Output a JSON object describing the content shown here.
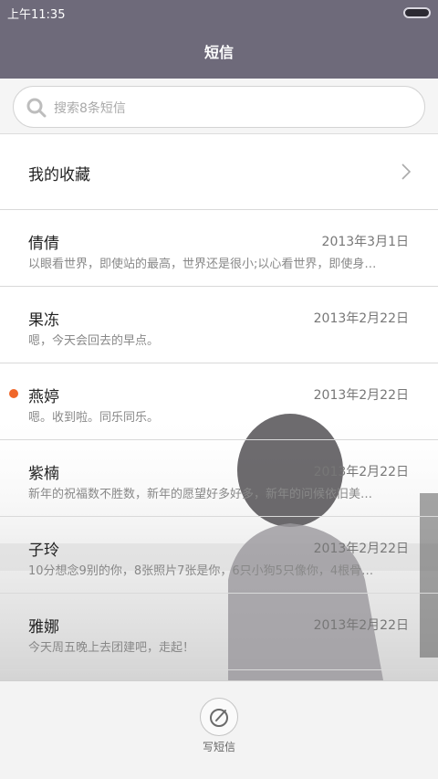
{
  "status_bar": {
    "time": "上午11:35"
  },
  "header": {
    "title": "短信"
  },
  "search": {
    "placeholder": "搜索8条短信"
  },
  "favorites": {
    "label": "我的收藏"
  },
  "messages": [
    {
      "name": "倩倩",
      "date": "2013年3月1日",
      "preview": "以眼看世界，即使站的最高，世界还是很小;以心看世界，即使身…",
      "unread": false
    },
    {
      "name": "果冻",
      "date": "2013年2月22日",
      "preview": "嗯，今天会回去的早点。",
      "unread": false
    },
    {
      "name": "燕婷",
      "date": "2013年2月22日",
      "preview": "嗯。收到啦。同乐同乐。",
      "unread": true
    },
    {
      "name": "紫楠",
      "date": "2013年2月22日",
      "preview": "新年的祝福数不胜数，新年的愿望好多好多，新年的问候依旧美…",
      "unread": false
    },
    {
      "name": "子玲",
      "date": "2013年2月22日",
      "preview": "10分想念9别的你，8张照片7张是你，6只小狗5只像你，4根骨…",
      "unread": false
    },
    {
      "name": "雅娜",
      "date": "2013年2月22日",
      "preview": "今天周五晚上去团建吧，走起！",
      "unread": false
    }
  ],
  "bottom": {
    "compose_label": "写短信"
  },
  "colors": {
    "header_bg": "#6e6a7a",
    "unread_dot": "#f0672a"
  },
  "icons": {
    "search": "search-icon",
    "chevron": "chevron-right-icon",
    "compose": "compose-icon"
  }
}
